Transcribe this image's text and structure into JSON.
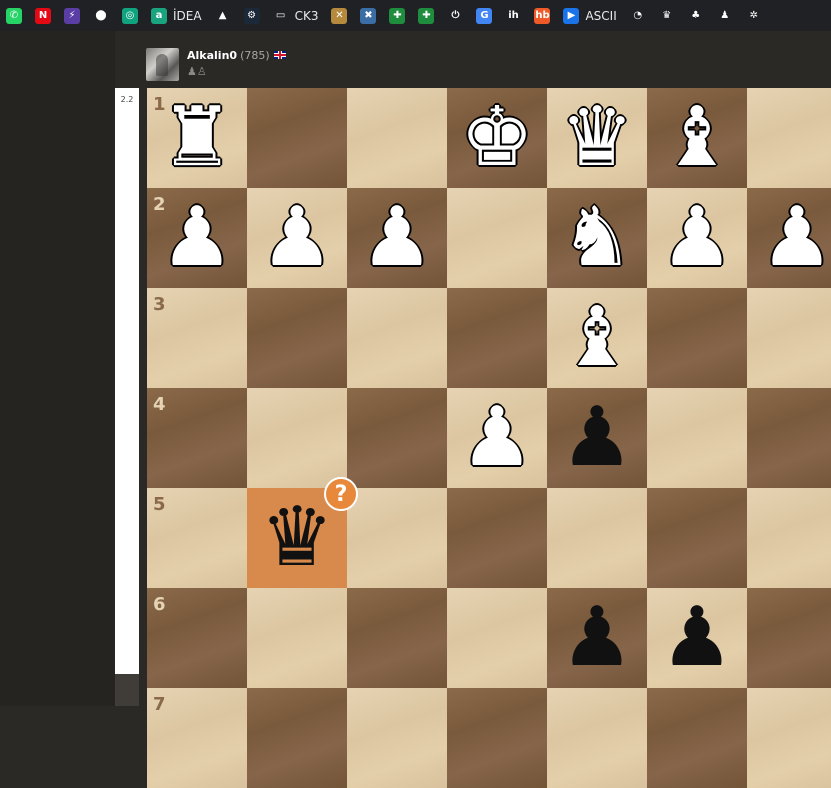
{
  "bookmarks": [
    {
      "name": "whatsapp",
      "icon": "whatsapp-icon",
      "glyph": "✆",
      "color": "#25d366",
      "label": ""
    },
    {
      "name": "netflix",
      "icon": "netflix-icon",
      "glyph": "N",
      "color": "#e50914",
      "label": ""
    },
    {
      "name": "bolt",
      "icon": "bolt-icon",
      "glyph": "⚡",
      "color": "#5b3ea5",
      "label": ""
    },
    {
      "name": "maps",
      "icon": "map-pin-icon",
      "glyph": "⬤",
      "color": "#202124",
      "label": ""
    },
    {
      "name": "chatgpt",
      "icon": "openai-icon",
      "glyph": "◎",
      "color": "#10a37f",
      "label": ""
    },
    {
      "name": "idea",
      "icon": "idea-icon",
      "glyph": "a",
      "color": "#1aa37f",
      "label": "İDEA"
    },
    {
      "name": "up",
      "icon": "caret-up-icon",
      "glyph": "▲",
      "color": "#202124",
      "label": ""
    },
    {
      "name": "steam",
      "icon": "steam-icon",
      "glyph": "⚙",
      "color": "#1b2838",
      "label": ""
    },
    {
      "name": "ck3-folder",
      "icon": "folder-icon",
      "glyph": "▭",
      "color": "#202124",
      "label": "CK3"
    },
    {
      "name": "chess-puzzle",
      "icon": "puzzle-icon",
      "glyph": "✕",
      "color": "#b58a3c",
      "label": ""
    },
    {
      "name": "cross-app",
      "icon": "cross-icon",
      "glyph": "✖",
      "color": "#3a6ea5",
      "label": ""
    },
    {
      "name": "sheets-1",
      "icon": "sheets-icon",
      "glyph": "✚",
      "color": "#1e8e3e",
      "label": ""
    },
    {
      "name": "sheets-2",
      "icon": "sheets-icon",
      "glyph": "✚",
      "color": "#1e8e3e",
      "label": ""
    },
    {
      "name": "power",
      "icon": "power-icon",
      "glyph": "⏻",
      "color": "#202124",
      "label": ""
    },
    {
      "name": "translate",
      "icon": "translate-icon",
      "glyph": "G",
      "color": "#4285f4",
      "label": ""
    },
    {
      "name": "ih",
      "icon": "ih-icon",
      "glyph": "ih",
      "color": "#202124",
      "label": ""
    },
    {
      "name": "hb",
      "icon": "hb-icon",
      "glyph": "hb",
      "color": "#f05a28",
      "label": ""
    },
    {
      "name": "ascii",
      "icon": "play-icon",
      "glyph": "▶",
      "color": "#1a73e8",
      "label": "ASCII"
    },
    {
      "name": "speed",
      "icon": "gauge-icon",
      "glyph": "◔",
      "color": "#202124",
      "label": ""
    },
    {
      "name": "crown",
      "icon": "crown-icon",
      "glyph": "♛",
      "color": "#202124",
      "label": ""
    },
    {
      "name": "tree",
      "icon": "tree-icon",
      "glyph": "♣",
      "color": "#202124",
      "label": ""
    },
    {
      "name": "pawn",
      "icon": "chess-pawn-icon",
      "glyph": "♟",
      "color": "#202124",
      "label": ""
    },
    {
      "name": "cog",
      "icon": "cog-icon",
      "glyph": "✲",
      "color": "#202124",
      "label": ""
    }
  ],
  "eval": {
    "value": "2.2"
  },
  "player": {
    "name": "Alkalin0",
    "rating": "(785)",
    "flag": "uk-flag-icon",
    "captured": "♟♙"
  },
  "board": {
    "colors": {
      "light": "#e6d3b3",
      "dark": "#8b6a4a",
      "highlight": "#d78a4c",
      "badge": "#e8883a"
    },
    "rank_labels": [
      "1",
      "2",
      "3",
      "4",
      "5",
      "6",
      "7"
    ],
    "pieces": [
      {
        "rank": 1,
        "file": "h",
        "col": 0,
        "row": 0,
        "color": "white",
        "type": "rook",
        "glyph": "♜"
      },
      {
        "rank": 1,
        "file": "e",
        "col": 3,
        "row": 0,
        "color": "white",
        "type": "king",
        "glyph": "♚"
      },
      {
        "rank": 1,
        "file": "d",
        "col": 4,
        "row": 0,
        "color": "white",
        "type": "queen",
        "glyph": "♛"
      },
      {
        "rank": 1,
        "file": "c",
        "col": 5,
        "row": 0,
        "color": "white",
        "type": "bishop",
        "glyph": "♝"
      },
      {
        "rank": 2,
        "file": "h",
        "col": 0,
        "row": 1,
        "color": "white",
        "type": "pawn",
        "glyph": "♟"
      },
      {
        "rank": 2,
        "file": "g",
        "col": 1,
        "row": 1,
        "color": "white",
        "type": "pawn",
        "glyph": "♟"
      },
      {
        "rank": 2,
        "file": "f",
        "col": 2,
        "row": 1,
        "color": "white",
        "type": "pawn",
        "glyph": "♟"
      },
      {
        "rank": 2,
        "file": "d",
        "col": 4,
        "row": 1,
        "color": "white",
        "type": "knight",
        "glyph": "♞"
      },
      {
        "rank": 2,
        "file": "c",
        "col": 5,
        "row": 1,
        "color": "white",
        "type": "pawn",
        "glyph": "♟"
      },
      {
        "rank": 2,
        "file": "b",
        "col": 6,
        "row": 1,
        "color": "white",
        "type": "pawn",
        "glyph": "♟"
      },
      {
        "rank": 3,
        "file": "d",
        "col": 4,
        "row": 2,
        "color": "white",
        "type": "bishop",
        "glyph": "♝"
      },
      {
        "rank": 4,
        "file": "e",
        "col": 3,
        "row": 3,
        "color": "white",
        "type": "pawn",
        "glyph": "♟"
      },
      {
        "rank": 4,
        "file": "d",
        "col": 4,
        "row": 3,
        "color": "black",
        "type": "pawn",
        "glyph": "♟"
      },
      {
        "rank": 5,
        "file": "g",
        "col": 1,
        "row": 4,
        "color": "black",
        "type": "queen",
        "glyph": "♛"
      },
      {
        "rank": 6,
        "file": "d",
        "col": 4,
        "row": 5,
        "color": "black",
        "type": "pawn",
        "glyph": "♟"
      },
      {
        "rank": 6,
        "file": "c",
        "col": 5,
        "row": 5,
        "color": "black",
        "type": "pawn",
        "glyph": "♟"
      }
    ],
    "highlight": {
      "col": 1,
      "row": 4
    },
    "badge": {
      "text": "?",
      "meaning": "mistake"
    }
  }
}
